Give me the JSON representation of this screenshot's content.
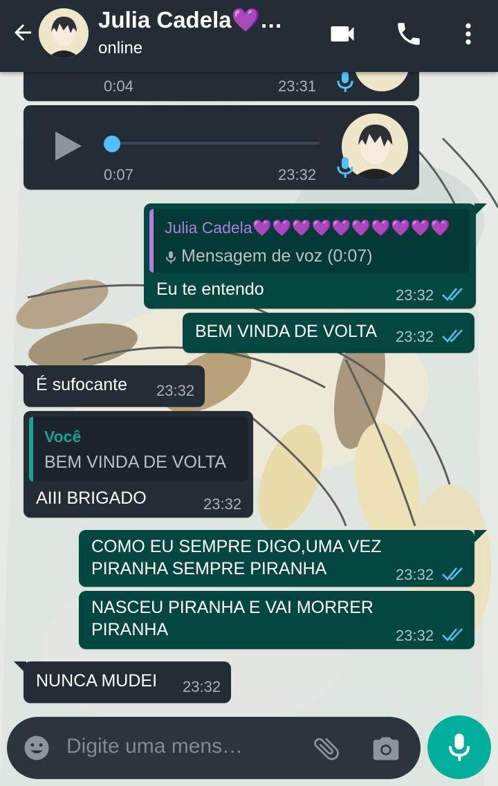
{
  "header": {
    "back_icon": "arrow-left-icon",
    "contact_name": "Julia Cadela💜…",
    "status": "online",
    "icons": [
      "video-call-icon",
      "phone-call-icon",
      "more-vert-icon"
    ]
  },
  "messages": {
    "voice1": {
      "duration": "0:04",
      "time": "23:31"
    },
    "voice2": {
      "duration": "0:07",
      "time": "23:32"
    },
    "reply1": {
      "quote_name": "Julia Cadela💜💜💜💜💜💜💜💜💜💜",
      "quote_text": "Mensagem de voz (0:07)",
      "text": "Eu te entendo",
      "time": "23:32"
    },
    "out2": {
      "text": "BEM VINDA DE VOLTA",
      "time": "23:32"
    },
    "in3": {
      "text": "É sufocante",
      "time": "23:32"
    },
    "in4": {
      "quote_name": "Você",
      "quote_text": "BEM VINDA DE VOLTA",
      "text": "AIII BRIGADO",
      "time": "23:32"
    },
    "out5": {
      "line1": "COMO EU SEMPRE DIGO,UMA VEZ",
      "line2": "PIRANHA SEMPRE PIRANHA",
      "time": "23:32"
    },
    "out6": {
      "line1": "NASCEU PIRANHA E VAI MORRER",
      "line2": "PIRANHA",
      "time": "23:32"
    },
    "in7": {
      "text": "NUNCA MUDEI",
      "time": "23:32"
    }
  },
  "composer": {
    "placeholder": "Digite uma mens…",
    "icons": [
      "emoji-icon",
      "attach-icon",
      "camera-icon",
      "mic-icon"
    ]
  },
  "colors": {
    "header_bg": "#232d36",
    "incoming_bubble": "#232d36",
    "outgoing_bubble": "#044741",
    "accent": "#00af9c",
    "read_ticks": "#53bdeb",
    "quote_purple": "#b37ee0",
    "quote_green": "#17a392"
  }
}
